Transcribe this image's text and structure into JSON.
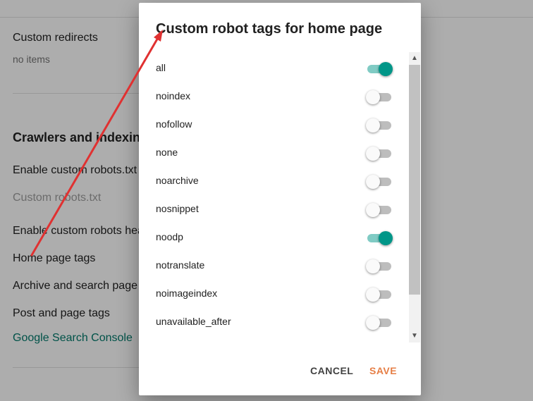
{
  "background": {
    "custom_redirects": "Custom redirects",
    "custom_redirects_value": "no items",
    "section_heading": "Crawlers and indexing",
    "enable_robots_txt": "Enable custom robots.txt",
    "robots_txt_label": "Custom robots.txt",
    "enable_robots_header": "Enable custom robots header tags",
    "home_page_tags": "Home page tags",
    "archive_search_tags": "Archive and search page tags",
    "post_page_tags": "Post and page tags",
    "search_console_link": "Google Search Console"
  },
  "dialog": {
    "title": "Custom robot tags for home page",
    "tags": [
      {
        "label": "all",
        "on": true
      },
      {
        "label": "noindex",
        "on": false
      },
      {
        "label": "nofollow",
        "on": false
      },
      {
        "label": "none",
        "on": false
      },
      {
        "label": "noarchive",
        "on": false
      },
      {
        "label": "nosnippet",
        "on": false
      },
      {
        "label": "noodp",
        "on": true
      },
      {
        "label": "notranslate",
        "on": false
      },
      {
        "label": "noimageindex",
        "on": false
      },
      {
        "label": "unavailable_after",
        "on": false
      }
    ],
    "cancel_label": "CANCEL",
    "save_label": "SAVE"
  },
  "colors": {
    "toggle_on": "#009688",
    "save_button": "#e67e45",
    "link": "#00796b",
    "annotation_arrow": "#e03131"
  },
  "icons": {
    "scroll_up": "▲",
    "scroll_down": "▼"
  }
}
